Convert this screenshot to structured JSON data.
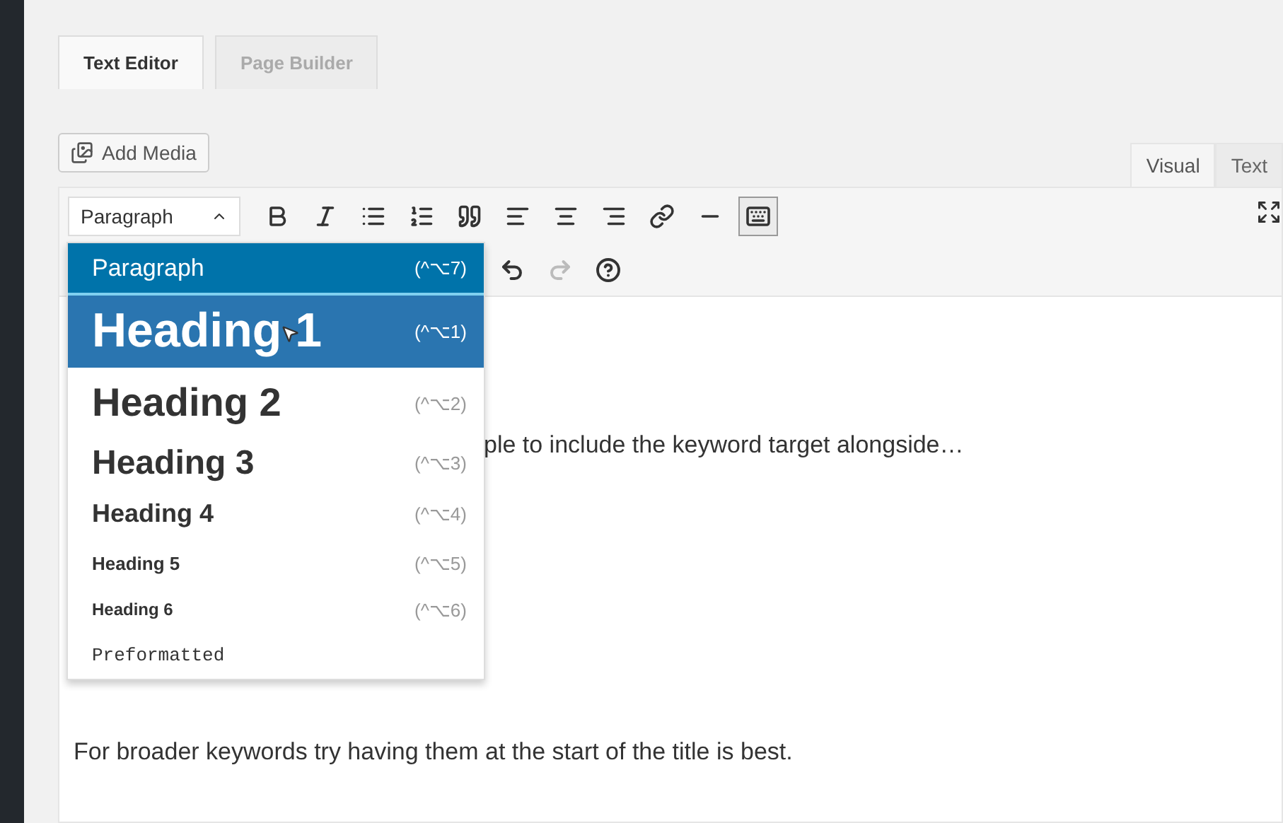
{
  "builder_tabs": [
    {
      "label": "Text Editor",
      "selected": true
    },
    {
      "label": "Page Builder",
      "selected": false
    }
  ],
  "add_media": {
    "label": "Add Media"
  },
  "mode_tabs": [
    {
      "label": "Visual",
      "selected": true
    },
    {
      "label": "Text",
      "selected": false
    }
  ],
  "format_select": {
    "value": "Paragraph",
    "expanded": true
  },
  "toolbar_row1": [
    {
      "kind": "bold",
      "pressed": false
    },
    {
      "kind": "italic",
      "pressed": false
    },
    {
      "kind": "bullets",
      "pressed": false
    },
    {
      "kind": "numbers",
      "pressed": false
    },
    {
      "kind": "quote",
      "pressed": false
    },
    {
      "kind": "align-left",
      "pressed": false
    },
    {
      "kind": "align-center",
      "pressed": false
    },
    {
      "kind": "align-right",
      "pressed": false
    },
    {
      "kind": "link",
      "pressed": false
    },
    {
      "kind": "more",
      "pressed": false
    },
    {
      "kind": "kitchen-sink",
      "pressed": true
    }
  ],
  "toolbar_row2": [
    {
      "kind": "undo",
      "disabled": false
    },
    {
      "kind": "redo",
      "disabled": true
    },
    {
      "kind": "help",
      "disabled": false
    }
  ],
  "format_menu": [
    {
      "kind": "p",
      "label": "Paragraph",
      "shortcut": "(^⌥7)",
      "selected": true,
      "hovered": false
    },
    {
      "kind": "h1",
      "label": "Heading 1",
      "shortcut": "(^⌥1)",
      "selected": false,
      "hovered": true
    },
    {
      "kind": "h2",
      "label": "Heading 2",
      "shortcut": "(^⌥2)",
      "selected": false,
      "hovered": false
    },
    {
      "kind": "h3",
      "label": "Heading 3",
      "shortcut": "(^⌥3)",
      "selected": false,
      "hovered": false
    },
    {
      "kind": "h4",
      "label": "Heading 4",
      "shortcut": "(^⌥4)",
      "selected": false,
      "hovered": false
    },
    {
      "kind": "h5",
      "label": "Heading 5",
      "shortcut": "(^⌥5)",
      "selected": false,
      "hovered": false
    },
    {
      "kind": "h6",
      "label": "Heading 6",
      "shortcut": "(^⌥6)",
      "selected": false,
      "hovered": false
    },
    {
      "kind": "pre",
      "label": "Preformatted",
      "selected": false,
      "hovered": false
    }
  ],
  "content": [
    "ple to include the keyword target alongside…",
    "For broader keywords try having them at the start of the title is best."
  ]
}
